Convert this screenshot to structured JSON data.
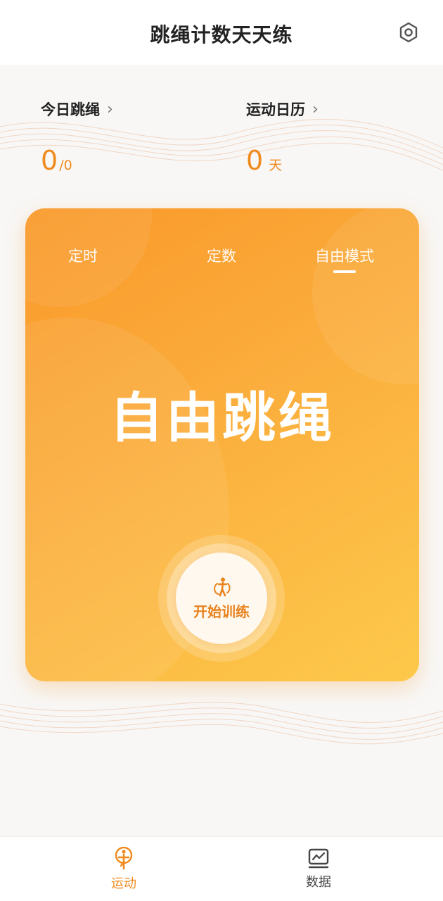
{
  "header": {
    "title": "跳绳计数天天练",
    "settings_icon": "gear-icon"
  },
  "stats": {
    "today": {
      "title": "今日跳绳",
      "value": "0",
      "total": "/0"
    },
    "calendar": {
      "title": "运动日历",
      "value": "0",
      "unit": "天"
    },
    "chevron": "›"
  },
  "card": {
    "tabs": [
      {
        "label": "定时"
      },
      {
        "label": "定数"
      },
      {
        "label": "自由模式",
        "active": true
      }
    ],
    "mode_title": "自由跳绳",
    "start_label": "开始训练",
    "start_icon": "jump-rope-icon"
  },
  "bottom_nav": {
    "items": [
      {
        "label": "运动",
        "icon": "run-icon",
        "active": true
      },
      {
        "label": "数据",
        "icon": "chart-icon",
        "active": false
      }
    ]
  },
  "colors": {
    "accent": "#f08a1c",
    "card_start": "#f9982a",
    "card_end": "#fdc94b"
  }
}
